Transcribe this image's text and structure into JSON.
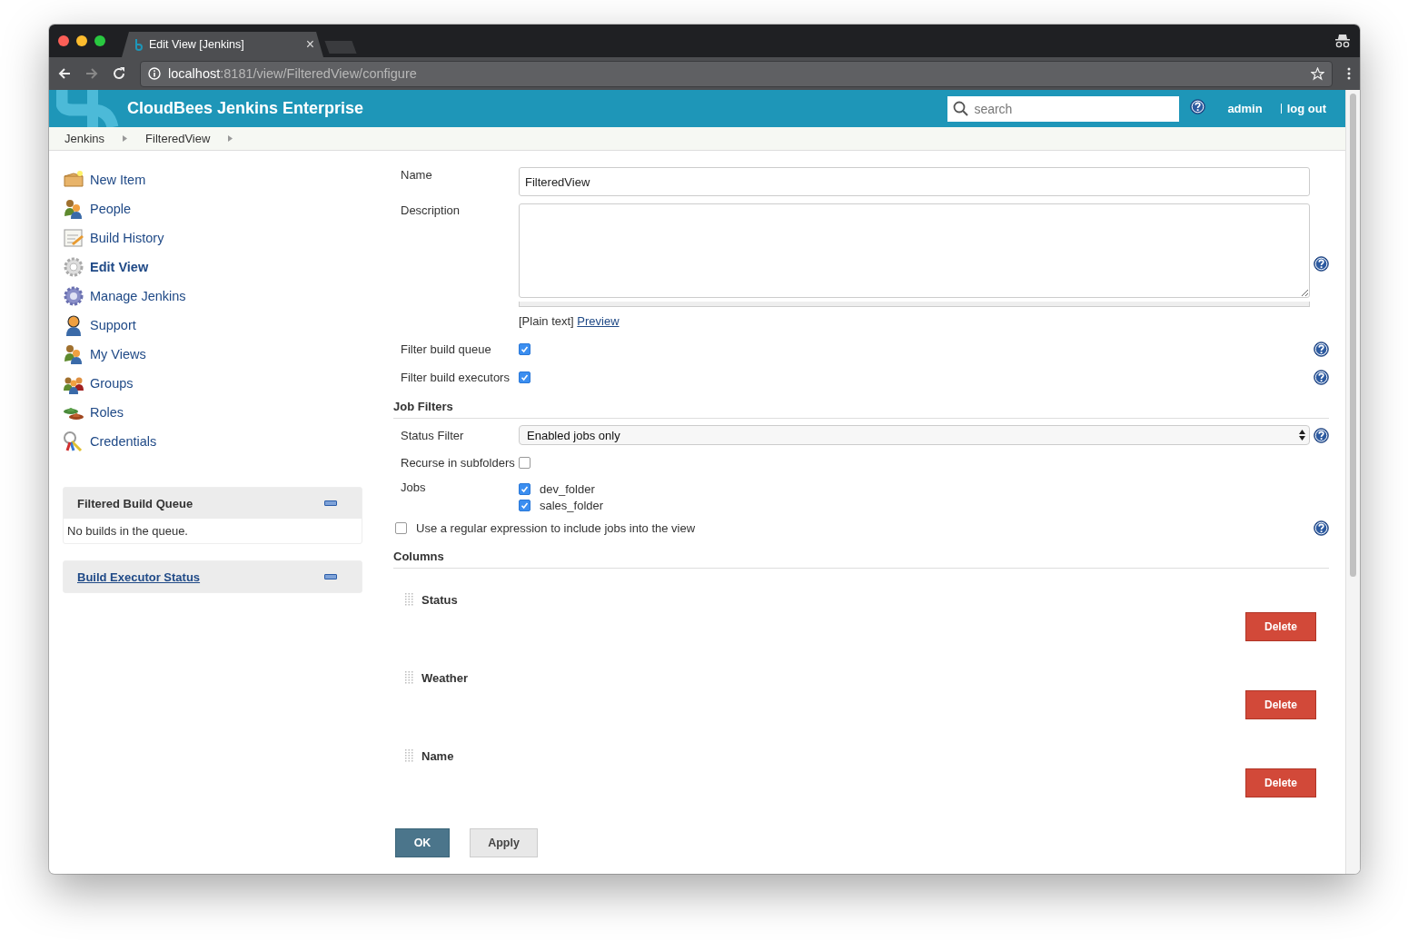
{
  "browser": {
    "tab_title": "Edit View [Jenkins]",
    "tab_close": "×",
    "url_host": "localhost",
    "url_path": ":8181/view/FilteredView/configure"
  },
  "header": {
    "brand": "CloudBees Jenkins Enterprise",
    "search": {
      "placeholder": "search"
    },
    "user": "admin",
    "logout": "log out"
  },
  "breadcrumbs": [
    "Jenkins",
    "FilteredView"
  ],
  "sidebar": {
    "items": [
      {
        "label": "New Item",
        "selected": false
      },
      {
        "label": "People",
        "selected": false
      },
      {
        "label": "Build History",
        "selected": false
      },
      {
        "label": "Edit View",
        "selected": true
      },
      {
        "label": "Manage Jenkins",
        "selected": false
      },
      {
        "label": "Support",
        "selected": false
      },
      {
        "label": "My Views",
        "selected": false
      },
      {
        "label": "Groups",
        "selected": false
      },
      {
        "label": "Roles",
        "selected": false
      },
      {
        "label": "Credentials",
        "selected": false
      }
    ],
    "panels": [
      {
        "title": "Filtered Build Queue",
        "kind": "text",
        "body": "No builds in the queue."
      },
      {
        "title": "Build Executor Status",
        "kind": "link"
      }
    ]
  },
  "form": {
    "name": {
      "label": "Name",
      "value": "FilteredView"
    },
    "description": {
      "label": "Description",
      "format": "[Plain text]",
      "preview": "Preview"
    },
    "options": [
      {
        "label": "Filter build queue",
        "checked": true
      },
      {
        "label": "Filter build executors",
        "checked": true
      }
    ],
    "job_filters": {
      "title": "Job Filters",
      "status_filter": {
        "label": "Status Filter",
        "value": "Enabled jobs only"
      },
      "recurse": {
        "label": "Recurse in subfolders",
        "checked": false
      },
      "jobs": {
        "label": "Jobs",
        "items": [
          {
            "label": "dev_folder",
            "checked": true
          },
          {
            "label": "sales_folder",
            "checked": true
          }
        ]
      },
      "regex": {
        "label": "Use a regular expression to include jobs into the view",
        "checked": false
      }
    },
    "columns": {
      "title": "Columns",
      "items": [
        {
          "name": "Status",
          "button": "Delete"
        },
        {
          "name": "Weather",
          "button": "Delete"
        },
        {
          "name": "Name",
          "button": "Delete"
        }
      ]
    },
    "buttons": [
      {
        "label": "OK",
        "kind": "primary"
      },
      {
        "label": "Apply",
        "kind": "secondary"
      }
    ]
  }
}
